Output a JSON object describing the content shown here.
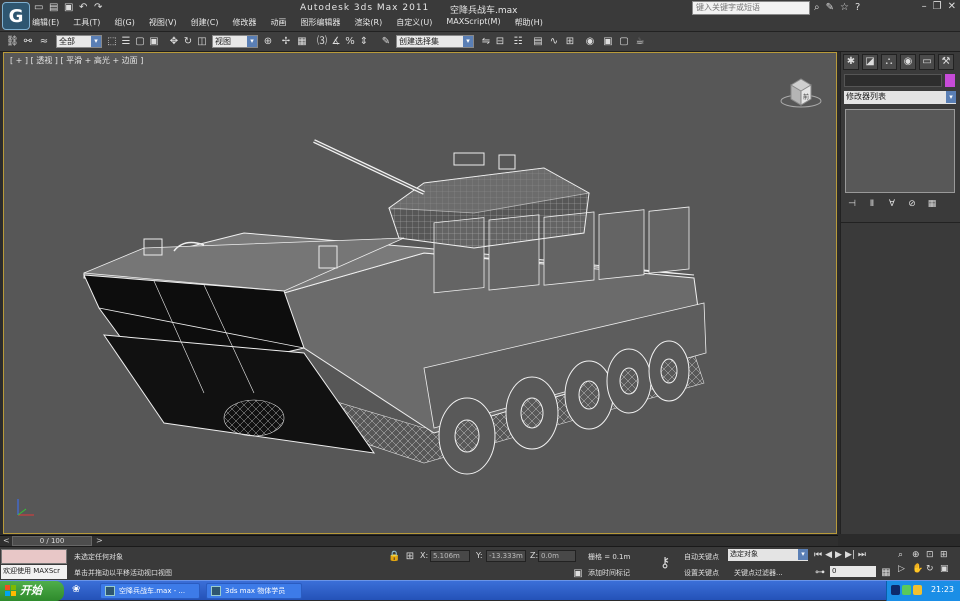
{
  "title": {
    "app_name": "Autodesk 3ds Max  2011",
    "file_name": "空降兵战车.max",
    "search_placeholder": "键入关键字或短语",
    "quick_access": [
      "new-icon",
      "open-icon",
      "save-icon",
      "undo-icon",
      "redo-icon"
    ]
  },
  "menu": [
    "编辑(E)",
    "工具(T)",
    "组(G)",
    "视图(V)",
    "创建(C)",
    "修改器",
    "动画",
    "图形编辑器",
    "渲染(R)",
    "自定义(U)",
    "MAXScript(M)",
    "帮助(H)"
  ],
  "toolbar": {
    "selection_filter": "全部",
    "reference_coord": "视图",
    "named_selection": "创建选择集"
  },
  "viewport": {
    "label": "[ + ] [ 透视 ] [ 平滑 + 高光 + 边面 ]",
    "viewcube_label": "前"
  },
  "command_panel": {
    "modifier_list": "修改器列表",
    "name_color": "#c74bd8"
  },
  "timeline": {
    "frame_range": "0 / 100",
    "prev": "<",
    "next": ">"
  },
  "status": {
    "maxscript_welcome": "欢迎使用 MAXScr",
    "selection_status": "未选定任何对象",
    "prompt": "单击并拖动以平移活动视口视图",
    "x_label": "X:",
    "x_value": "5.106m",
    "y_label": "Y:",
    "y_value": "-13.333m",
    "z_label": "Z:",
    "z_value": "0.0m",
    "grid": "栅格 = 0.1m",
    "add_time_tag": "添加时间标记",
    "auto_key": "自动关键点",
    "set_key": "设置关键点",
    "selected_set": "选定对象",
    "key_filters": "关键点过滤器...",
    "frame": "0"
  },
  "taskbar": {
    "start_label": "开始",
    "tasks": [
      "空降兵战车.max - ...",
      "3ds max 物体学员"
    ],
    "clock": "21:23"
  }
}
